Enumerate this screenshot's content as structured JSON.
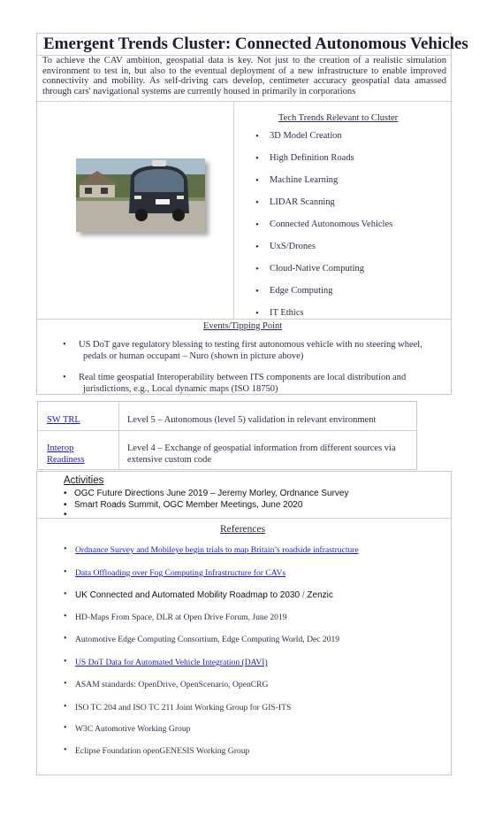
{
  "title": "Emergent Trends Cluster: Connected Autonomous Vehicles",
  "intro": "To achieve the CAV ambition, geospatial data is key. Not just to the creation of a realistic simulation environment to test in, but also to the eventual deployment of a new infrastructure to enable improved connectivity and mobility. As self-driving cars develop, centimeter accuracy geospatial data amassed through cars' navigational systems are currently housed in primarily in corporations",
  "trends": {
    "heading": "Tech Trends Relevant to Cluster",
    "bullet": "•",
    "items": [
      "3D Model Creation",
      "High Definition Roads",
      "Machine Learning",
      "LIDAR Scanning",
      "Connected Autonomous Vehicles",
      "UxS/Drones",
      "Cloud-Native Computing",
      "Edge Computing",
      "IT Ethics"
    ]
  },
  "events": {
    "heading": "Events/Tipping Point",
    "items": [
      "US DoT gave regulatory blessing to testing first autonomous vehicle with no steering wheel, pedals or human occupant – Nuro (shown in picture above)",
      "Real time geospatial Interoperability between ITS components are local distribution and jurisdictions, e.g., Local dynamic maps (ISO 18750)"
    ]
  },
  "readiness": {
    "rows": [
      {
        "label": "SW TRL",
        "value": "Level 5 – Autonomous (level 5) validation in relevant environment"
      },
      {
        "label_line1": "Interop",
        "label_line2": "Readiness",
        "value": "Level 4 – Exchange of geospatial information from different sources via extensive custom code"
      }
    ]
  },
  "activities": {
    "heading": "Activities",
    "items": [
      "OGC Future Directions June 2019 – Jeremy Morley, Ordnance Survey",
      "Smart Roads Summit, OGC Member Meetings, June 2020",
      ""
    ]
  },
  "references": {
    "heading": "References",
    "items": [
      "Ordnance Survey and Mobileye begin trials to map Britain’s roadside infrastructure",
      "Data Offloading over Fog Computing Infrastructure for CAVs",
      "UK Connected and Automated Mobility Roadmap to 2030",
      "HD-Maps From Space, DLR at Open Drive Forum, June 2019",
      "Automotive Edge Computing Consortium, Edge Computing World, Dec 2019",
      "US DoT Data for Automated Vehicle Integration (DAVI)",
      "ASAM standards: OpenDrive, OpenScenario, OpenCRG",
      "ISO TC 204 and ISO TC 211 Joint Working Group for GIS-ITS",
      "W3C Automotive Working Group",
      "Eclipse Foundation openGENESIS Working Group"
    ],
    "roadmap_separator": "/",
    "roadmap_source": "Zenzic"
  },
  "colors": {
    "link": "#1a1ad0",
    "text": "#2f2f45",
    "border": "#c8c8c8"
  }
}
